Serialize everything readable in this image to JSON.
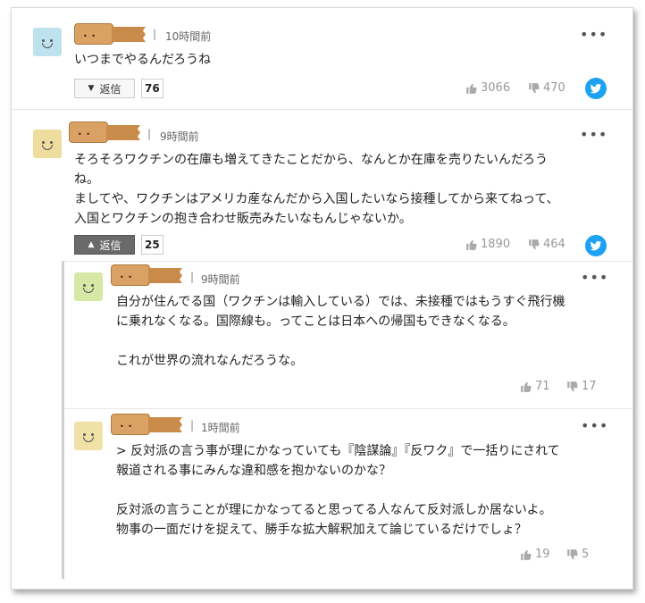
{
  "comments": [
    {
      "time": "10時間前",
      "text": "いつまでやるんだろうね",
      "reply_label": "返信",
      "reply_count": "76",
      "likes": "3066",
      "dislikes": "470",
      "avatar_color": "#bfe3ee"
    },
    {
      "time": "9時間前",
      "text": "そろそろワクチンの在庫も増えてきたことだから、なんとか在庫を売りたいんだろう\nね。\nましてや、ワクチンはアメリカ産なんだから入国したいなら接種してから来てねって、\n入国とワクチンの抱き合わせ販売みたいなもんじゃないか。",
      "reply_label": "返信",
      "reply_count": "25",
      "likes": "1890",
      "dislikes": "464",
      "avatar_color": "#eedd9e"
    }
  ],
  "replies": [
    {
      "time": "9時間前",
      "text": "自分が住んでる国（ワクチンは輸入している）では、未接種ではもうすぐ飛行機\nに乗れなくなる。国際線も。ってことは日本への帰国もできなくなる。\n\nこれが世界の流れなんだろうな。",
      "likes": "71",
      "dislikes": "17",
      "avatar_color": "#d6e8a6"
    },
    {
      "time": "1時間前",
      "text": "> 反対派の言う事が理にかなっていても『陰謀論』『反ワク』で一括りにされて\n報道される事にみんな違和感を抱かないのかな？\n\n反対派の言うことが理にかなってると思ってる人なんて反対派しか居ないよ。\n物事の一面だけを捉えて、勝手な拡大解釈加えて論じているだけでしょ？",
      "likes": "19",
      "dislikes": "5",
      "avatar_color": "#f0e2a6"
    }
  ],
  "ui": {
    "separator": "|",
    "more_icon": "•••",
    "avatar_face": "• •",
    "reply_tri_down": "▼",
    "reply_tri_up": "▲"
  }
}
